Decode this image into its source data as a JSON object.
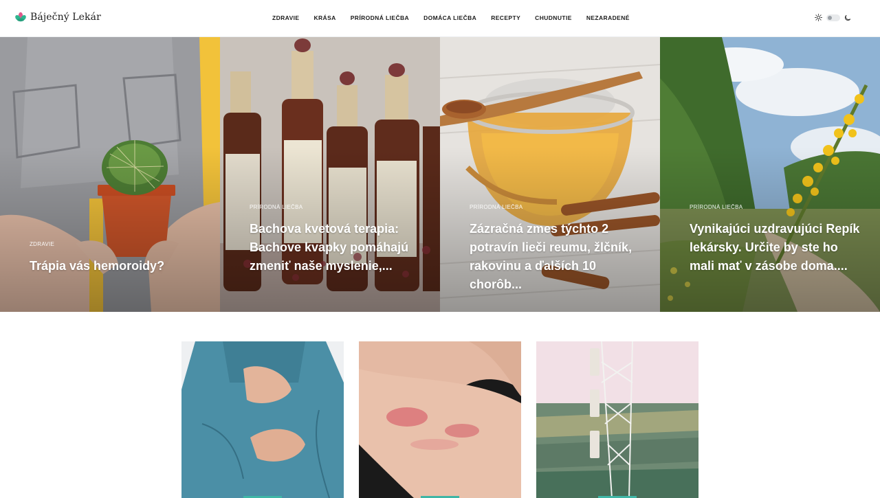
{
  "site": {
    "name": "Báječný Lekár"
  },
  "nav": [
    {
      "label": "ZDRAVIE"
    },
    {
      "label": "KRÁSA"
    },
    {
      "label": "PRÍRODNÁ LIEČBA"
    },
    {
      "label": "DOMÁCA LIEČBA"
    },
    {
      "label": "RECEPTY"
    },
    {
      "label": "CHUDNUTIE"
    },
    {
      "label": "NEZARADENÉ"
    }
  ],
  "theme": {
    "light_icon": "sun-icon",
    "dark_icon": "moon-icon"
  },
  "hero": [
    {
      "category": "ZDRAVIE",
      "title": "Trápia vás hemoroidy?"
    },
    {
      "category": "PRÍRODNÁ LIEČBA",
      "title": "Bachova kvetová terapia: Bachove kvapky pomáhajú zmeniť naše myslenie,..."
    },
    {
      "category": "PRÍRODNÁ LIEČBA",
      "title": "Zázračná zmes týchto 2 potravín lieči reumu, žlčník, rakovinu a ďalších 10 chorôb..."
    },
    {
      "category": "PRÍRODNÁ LIEČBA",
      "title": "Vynikajúci uzdravujúci Repík lekársky. Určite by ste ho mali mať v zásobe doma...."
    }
  ],
  "colors": {
    "accent": "#3fb6a6",
    "logo_pink": "#e05a8c",
    "logo_green": "#2fb58f"
  }
}
